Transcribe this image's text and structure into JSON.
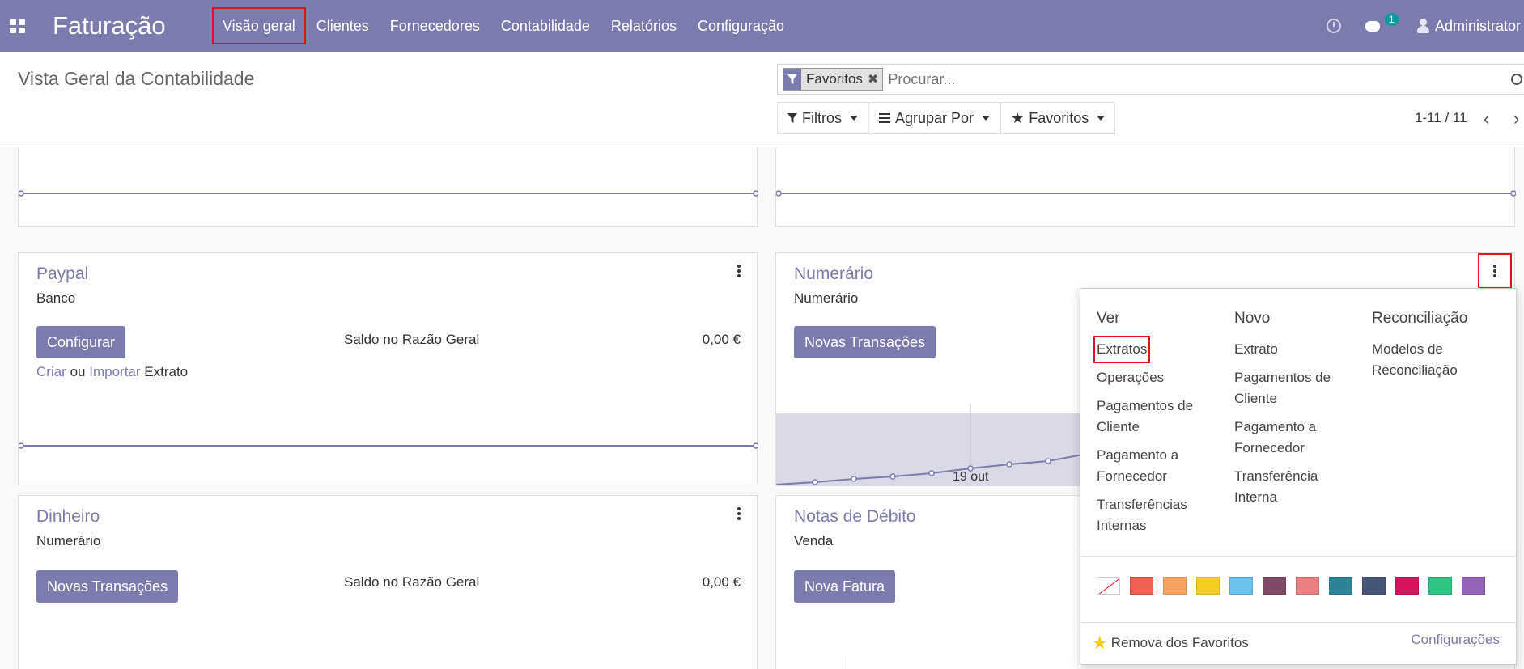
{
  "navbar": {
    "app_name": "Faturação",
    "menu": [
      "Visão geral",
      "Clientes",
      "Fornecedores",
      "Contabilidade",
      "Relatórios",
      "Configuração"
    ],
    "messages_badge": "1",
    "user_name": "Administrator"
  },
  "control_panel": {
    "title": "Vista Geral da Contabilidade",
    "facet": "Favoritos",
    "search_placeholder": "Procurar...",
    "filters_label": "Filtros",
    "groupby_label": "Agrupar Por",
    "favorites_label": "Favoritos",
    "pager": "1-11 / 11"
  },
  "cards": {
    "paypal": {
      "title": "Paypal",
      "subtitle": "Banco",
      "button": "Configurar",
      "balance_label": "Saldo no Razão Geral",
      "balance_value": "0,00 €",
      "link_create": "Criar",
      "or_text": "ou",
      "link_import": "Importar",
      "statement_text": "Extrato"
    },
    "numerario": {
      "title": "Numerário",
      "subtitle": "Numerário",
      "button": "Novas Transações",
      "graph_label": "19 out"
    },
    "dinheiro": {
      "title": "Dinheiro",
      "subtitle": "Numerário",
      "button": "Novas Transações",
      "balance_label": "Saldo no Razão Geral",
      "balance_value": "0,00 €"
    },
    "notas_debito": {
      "title": "Notas de Débito",
      "subtitle": "Venda",
      "button": "Nova Fatura"
    }
  },
  "dropdown": {
    "columns": [
      {
        "header": "Ver",
        "items": [
          "Extratos",
          "Operações",
          "Pagamentos de Cliente",
          "Pagamento a Fornecedor",
          "Transferências Internas"
        ]
      },
      {
        "header": "Novo",
        "items": [
          "Extrato",
          "Pagamentos de Cliente",
          "Pagamento a Fornecedor",
          "Transferência Interna"
        ]
      },
      {
        "header": "Reconciliação",
        "items": [
          "Modelos de Reconciliação"
        ]
      }
    ],
    "colors": [
      "#f06050",
      "#f4a460",
      "#f7cd1f",
      "#6cc1ed",
      "#814968",
      "#eb7e7f",
      "#2c8397",
      "#475577",
      "#d6145f",
      "#30c381",
      "#9365b8"
    ],
    "remove_favorites": "Remova dos Favoritos",
    "settings_link": "Configurações"
  }
}
